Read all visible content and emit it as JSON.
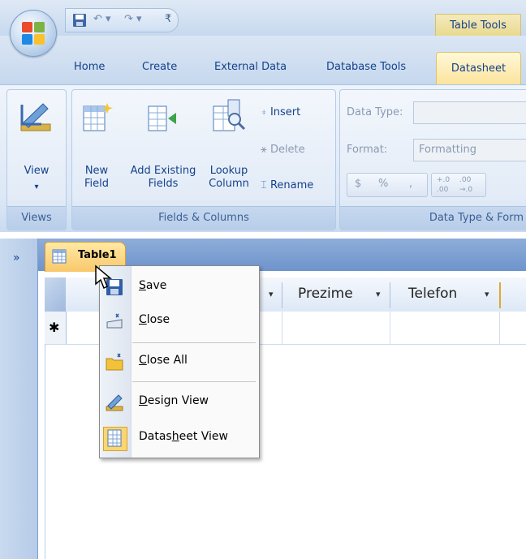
{
  "title_bar": {
    "context_tab": "Table Tools"
  },
  "ribbon": {
    "tabs": [
      "Home",
      "Create",
      "External Data",
      "Database Tools",
      "Datasheet"
    ],
    "active_tab": "Datasheet",
    "groups": {
      "views": {
        "label": "Views",
        "view_button": "View",
        "view_arrow": "▾"
      },
      "fields_columns": {
        "label": "Fields & Columns",
        "new_field": [
          "New",
          "Field"
        ],
        "add_existing": [
          "Add Existing",
          "Fields"
        ],
        "lookup_column": [
          "Lookup",
          "Column"
        ],
        "insert": "Insert",
        "delete": "Delete",
        "rename": "Rename"
      },
      "data_type": {
        "label": "Data Type & Form",
        "data_type_label": "Data Type:",
        "format_label": "Format:",
        "format_value": "Formatting",
        "currency": "$",
        "percent": "%",
        "comma": ",",
        "inc_decimal": "+.0 .00",
        "dec_decimal": ".00 →.0"
      }
    }
  },
  "nav_pane": {
    "toggle": "»"
  },
  "document": {
    "tab_label": "Table1",
    "columns": [
      {
        "name": "",
        "arrow": "▾"
      },
      {
        "name": "Prezime",
        "arrow": "▾"
      },
      {
        "name": "Telefon",
        "arrow": "▾"
      }
    ],
    "new_record_marker": "✱"
  },
  "context_menu": {
    "items": [
      {
        "label": "Save",
        "mnemonic": "S",
        "icon": "save-icon"
      },
      {
        "label": "Close",
        "mnemonic": "C",
        "icon": "close-icon"
      },
      {
        "label": "Close All",
        "mnemonic": "C",
        "icon": "close-all-icon"
      },
      {
        "label": "Design View",
        "mnemonic": "D",
        "icon": "design-view-icon"
      },
      {
        "label": "Datasheet View",
        "mnemonic": "h",
        "icon": "datasheet-view-icon"
      }
    ]
  },
  "colors": {
    "ribbon_text": "#15428b",
    "active_tab": "#fbe39b",
    "context_tab": "#e8d88b"
  }
}
